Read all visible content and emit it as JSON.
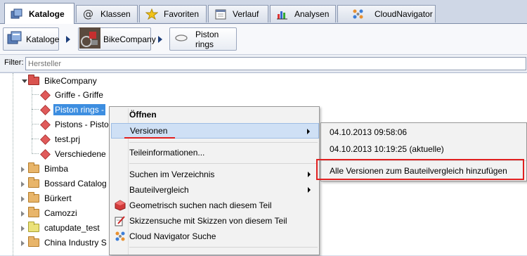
{
  "tabs": [
    {
      "label": "Kataloge",
      "icon": "catalog-icon",
      "active": true
    },
    {
      "label": "Klassen",
      "icon": "at-icon",
      "active": false
    },
    {
      "label": "Favoriten",
      "icon": "star-icon",
      "active": false
    },
    {
      "label": "Verlauf",
      "icon": "calendar-icon",
      "active": false
    },
    {
      "label": "Analysen",
      "icon": "bar-chart-icon",
      "active": false
    },
    {
      "label": "CloudNavigator",
      "icon": "cloud-navigator-icon",
      "active": false
    }
  ],
  "breadcrumb": [
    {
      "label": "Kataloge",
      "icon": "catalog-icon"
    },
    {
      "label": "BikeCompany",
      "icon": "bike-thumbnail-icon"
    },
    {
      "label": "Piston rings",
      "icon": "ring-icon"
    }
  ],
  "filter": {
    "label": "Filter:",
    "placeholder": "Hersteller"
  },
  "tree": {
    "items": [
      {
        "label": "BikeCompany",
        "icon": "folder-red-icon"
      },
      {
        "label": "Griffe - Griffe",
        "icon": "part-cube-icon"
      },
      {
        "label": "Piston rings - ",
        "icon": "part-cube-icon",
        "selected": true
      },
      {
        "label": "Pistons - Pisto",
        "icon": "part-cube-icon"
      },
      {
        "label": "test.prj",
        "icon": "part-cube-icon"
      },
      {
        "label": "Verschiedene",
        "icon": "part-cube-icon"
      },
      {
        "label": "Bimba",
        "icon": "folder-icon"
      },
      {
        "label": "Bossard Catalog",
        "icon": "folder-icon"
      },
      {
        "label": "Bürkert",
        "icon": "folder-icon"
      },
      {
        "label": "Camozzi",
        "icon": "folder-icon"
      },
      {
        "label": "catupdate_test",
        "icon": "folder-yellow-icon"
      },
      {
        "label": "China Industry S",
        "icon": "folder-icon"
      }
    ]
  },
  "context_menu": {
    "items": [
      {
        "label": "Öffnen",
        "bold": true
      },
      {
        "label": "Versionen",
        "submenu": true,
        "highlighted": true
      },
      {
        "label": "Teileinformationen..."
      },
      {
        "label": "Suchen im Verzeichnis",
        "submenu": true
      },
      {
        "label": "Bauteilvergleich",
        "submenu": true
      },
      {
        "label": "Geometrisch suchen nach diesem Teil",
        "icon": "geometry-search-icon"
      },
      {
        "label": "Skizzensuche mit Skizzen von diesem Teil",
        "icon": "sketch-search-icon"
      },
      {
        "label": "Cloud Navigator Suche",
        "icon": "cloud-navigator-icon"
      }
    ]
  },
  "versions_submenu": {
    "items": [
      {
        "label": "04.10.2013 09:58:06"
      },
      {
        "label": "04.10.2013 10:19:25 (aktuelle)"
      },
      {
        "label": "Alle Versionen zum Bauteilvergleich hinzufügen"
      }
    ]
  },
  "colors": {
    "selection": "#3d8ee0",
    "annotation": "#e02020",
    "menu_hover": "#cfe0f5"
  }
}
